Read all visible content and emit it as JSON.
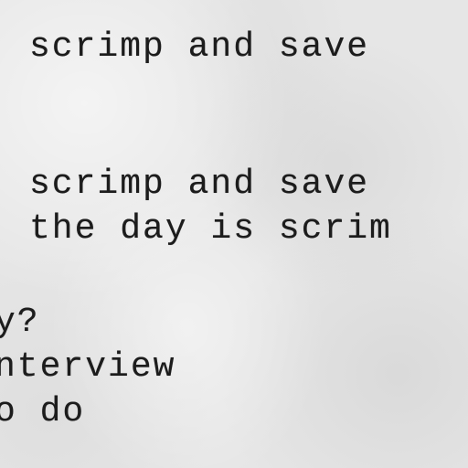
{
  "page": {
    "lines": [
      "scrimp and save",
      "scrimp and save",
      "the day is scrim",
      "y?",
      "nterview",
      "o do"
    ]
  }
}
